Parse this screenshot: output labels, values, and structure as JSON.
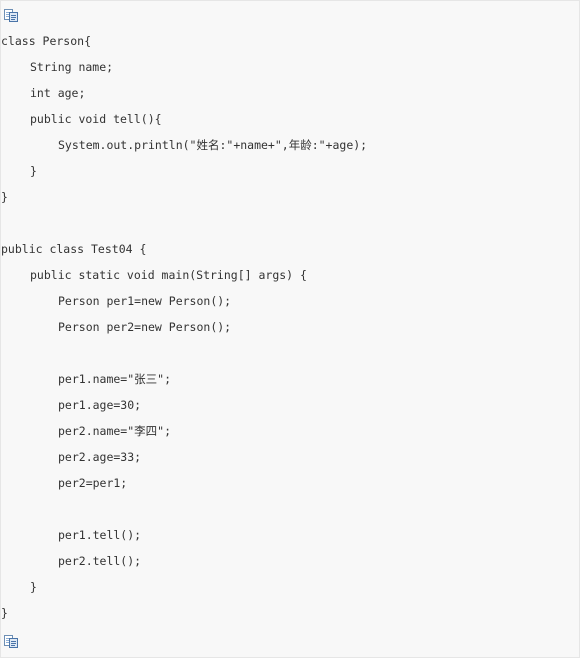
{
  "code_block": {
    "icons": {
      "top": "copy-code-icon",
      "bottom": "copy-code-icon"
    },
    "lines": [
      {
        "indent": 0,
        "text": "class Person{"
      },
      {
        "indent": 1,
        "text": "String name;"
      },
      {
        "indent": 1,
        "text": "int age;"
      },
      {
        "indent": 1,
        "text": "public void tell(){"
      },
      {
        "indent": 2,
        "text": "System.out.println(\"姓名:\"+name+\",年龄:\"+age);"
      },
      {
        "indent": 1,
        "text": "}"
      },
      {
        "indent": 0,
        "text": "}"
      },
      {
        "indent": 0,
        "text": ""
      },
      {
        "indent": 0,
        "text": "public class Test04 {"
      },
      {
        "indent": 1,
        "text": "public static void main(String[] args) {"
      },
      {
        "indent": 2,
        "text": "Person per1=new Person();"
      },
      {
        "indent": 2,
        "text": "Person per2=new Person();"
      },
      {
        "indent": 2,
        "text": ""
      },
      {
        "indent": 2,
        "text": "per1.name=\"张三\";"
      },
      {
        "indent": 2,
        "text": "per1.age=30;"
      },
      {
        "indent": 2,
        "text": "per2.name=\"李四\";"
      },
      {
        "indent": 2,
        "text": "per2.age=33;"
      },
      {
        "indent": 2,
        "text": "per2=per1;"
      },
      {
        "indent": 2,
        "text": ""
      },
      {
        "indent": 2,
        "text": "per1.tell();"
      },
      {
        "indent": 2,
        "text": "per2.tell();"
      },
      {
        "indent": 1,
        "text": "}"
      },
      {
        "indent": 0,
        "text": "}"
      }
    ]
  }
}
